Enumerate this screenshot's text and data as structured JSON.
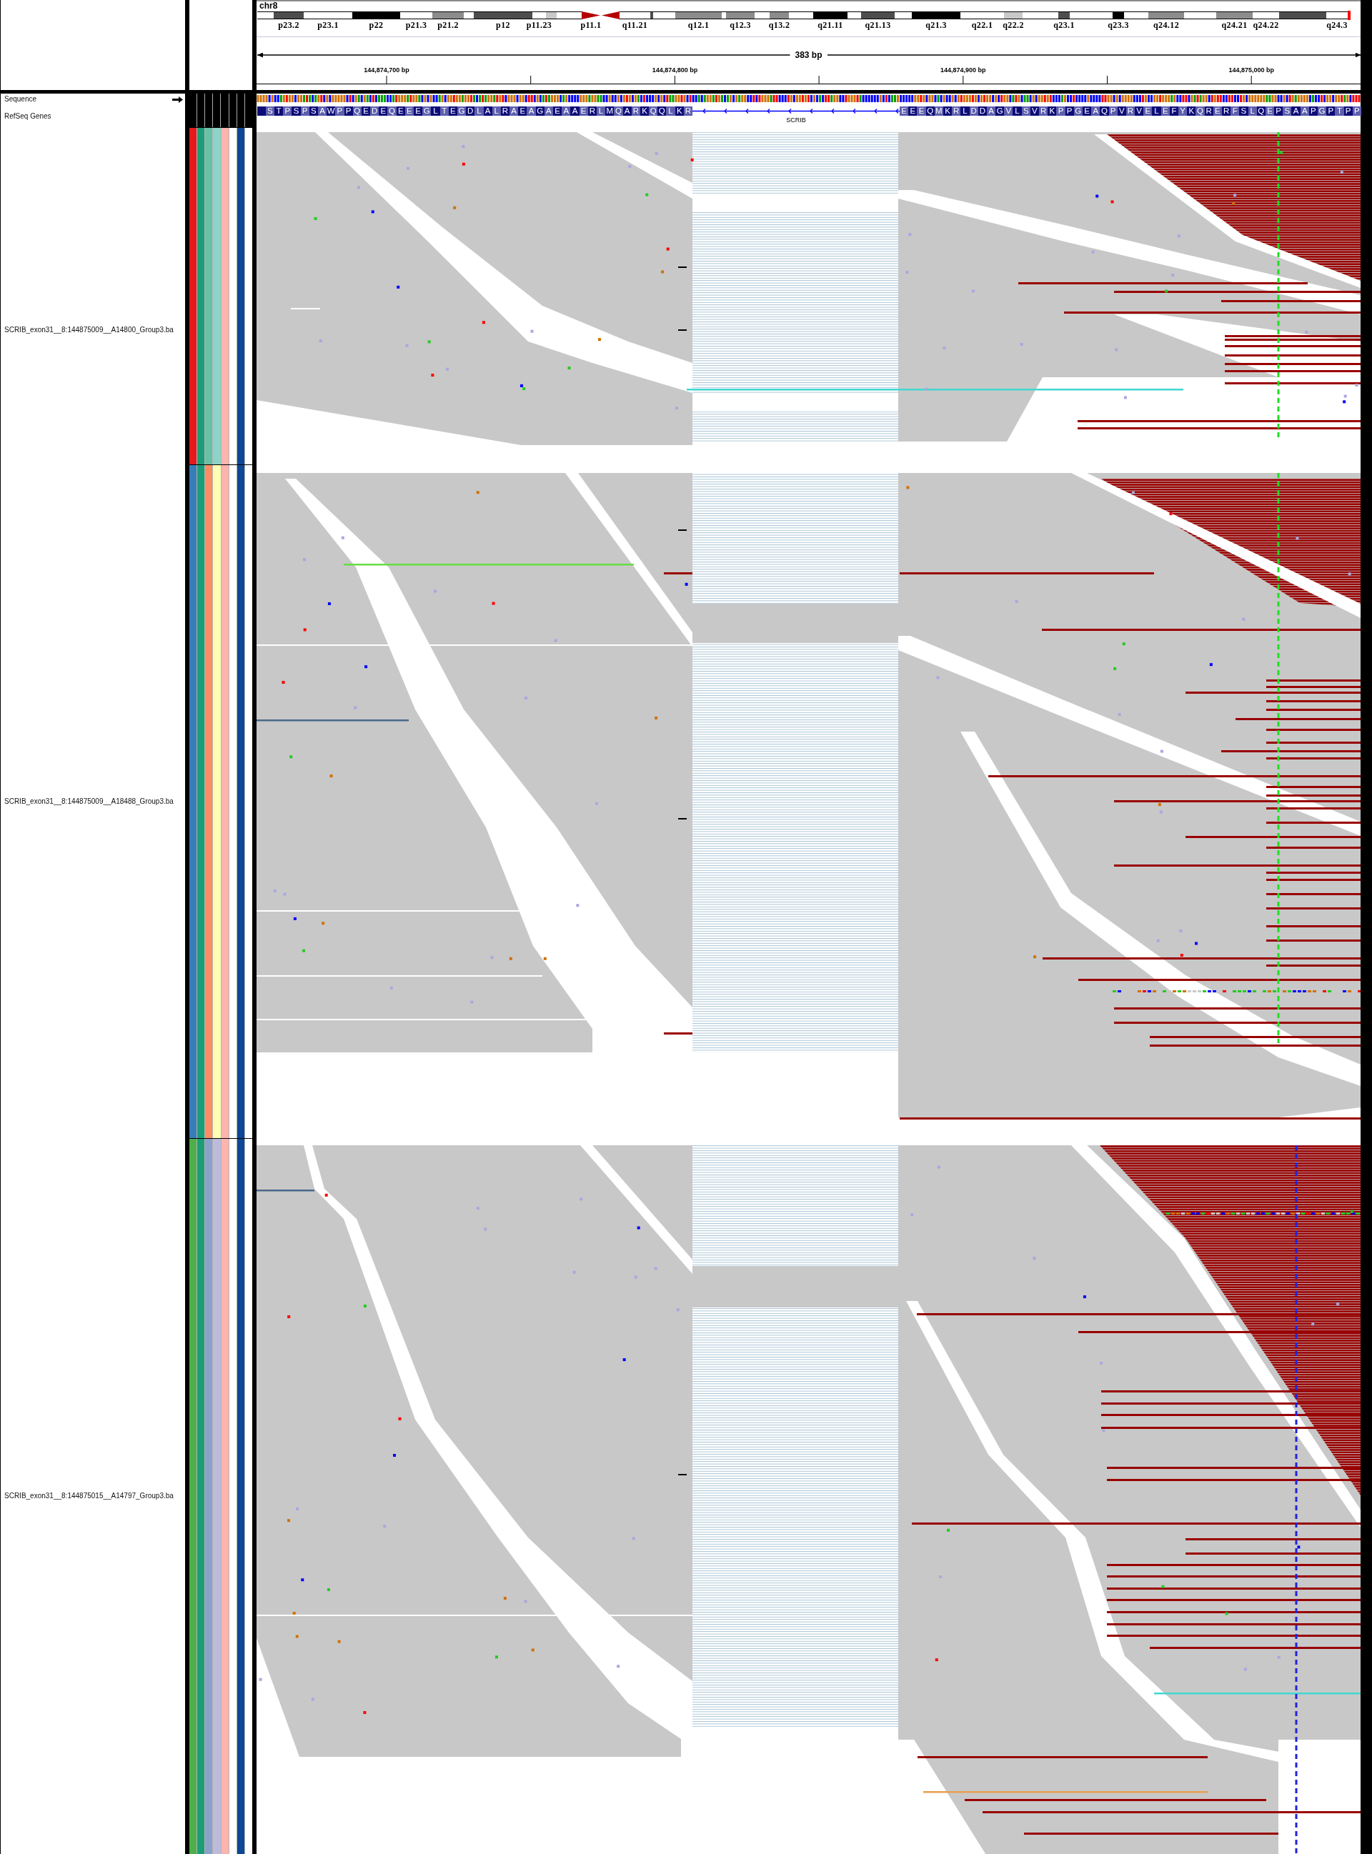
{
  "header": {
    "chromosome": "chr8",
    "ideogram": {
      "bands": [
        {
          "kind": "blank"
        },
        {
          "kind": "band",
          "color": "#4d4d4d",
          "label": "p23.2"
        },
        {
          "kind": "blank",
          "label": "p23.1"
        },
        {
          "kind": "band",
          "color": "#000000",
          "label": "p22"
        },
        {
          "kind": "blank",
          "label": "p21.3"
        },
        {
          "kind": "band",
          "color": "#8c8c8c",
          "label": "p21.2"
        },
        {
          "kind": "blank"
        },
        {
          "kind": "band",
          "color": "#4d4d4d",
          "label": "p12"
        },
        {
          "kind": "blank",
          "label": "p11.23"
        },
        {
          "kind": "band",
          "color": "#c8c8c8"
        },
        {
          "kind": "blank"
        },
        {
          "kind": "centromere",
          "color": "#b40000",
          "label": "p11.1"
        },
        {
          "kind": "centromere",
          "color": "#b40000"
        },
        {
          "kind": "blank",
          "label": "q11.21"
        },
        {
          "kind": "band",
          "color": "#4d4d4d"
        },
        {
          "kind": "blank"
        },
        {
          "kind": "band",
          "color": "#8c8c8c",
          "label": "q12.1"
        },
        {
          "kind": "blank"
        },
        {
          "kind": "band",
          "color": "#8c8c8c",
          "label": "q12.3"
        },
        {
          "kind": "blank"
        },
        {
          "kind": "band",
          "color": "#8c8c8c",
          "label": "q13.2"
        },
        {
          "kind": "blank"
        },
        {
          "kind": "band",
          "color": "#000000",
          "label": "q21.11"
        },
        {
          "kind": "blank"
        },
        {
          "kind": "band",
          "color": "#4d4d4d",
          "label": "q21.13"
        },
        {
          "kind": "blank"
        },
        {
          "kind": "band",
          "color": "#000000",
          "label": "q21.3"
        },
        {
          "kind": "blank",
          "label": "q22.1"
        },
        {
          "kind": "band",
          "color": "#c8c8c8",
          "label": "q22.2"
        },
        {
          "kind": "blank"
        },
        {
          "kind": "band",
          "color": "#4d4d4d",
          "label": "q23.1"
        },
        {
          "kind": "blank"
        },
        {
          "kind": "band",
          "color": "#000000",
          "label": "q23.3"
        },
        {
          "kind": "blank"
        },
        {
          "kind": "band",
          "color": "#8c8c8c",
          "label": "q24.12"
        },
        {
          "kind": "blank"
        },
        {
          "kind": "band",
          "color": "#8c8c8c",
          "label": "q24.21"
        },
        {
          "kind": "blank",
          "label": "q24.22"
        },
        {
          "kind": "band",
          "color": "#4d4d4d"
        },
        {
          "kind": "blank",
          "label": "q24.3"
        }
      ]
    },
    "ruler": {
      "span": "383 bp",
      "ticks": [
        "144,874,700 bp",
        "144,874,800 bp",
        "144,874,900 bp",
        "144,875,000 bp"
      ]
    }
  },
  "tracks": [
    {
      "kind": "sequence",
      "name": "Sequence"
    },
    {
      "kind": "gene",
      "name": "RefSeq Genes",
      "gene": "SCRIB",
      "exons": [
        "S T P S P S A W P P Q E D E Q E E E G L T E G D L A L R A E A G A E A A E R L M Q A R K Q Q L K R",
        "E E E Q M K R L D D A G V L S V R K P P G E A Q P V R V E L E F Y K Q R E R F S L Q E P S A A P G P T P P"
      ]
    },
    {
      "kind": "alignment",
      "name": "SCRIB_exon31__8:144875009__A14800_Group3.ba",
      "attributes": [
        {
          "color": "#e41a1c"
        },
        {
          "color": "#1b9e77"
        },
        {
          "color": "#66c2a5"
        },
        {
          "color": "#8dd3c7"
        },
        {
          "color": "#fbb4ae"
        },
        {
          "color": "#ffffff"
        },
        {
          "color": "#0c4896"
        },
        {
          "color": "#ffffff"
        }
      ]
    },
    {
      "kind": "alignment",
      "name": "SCRIB_exon31__8:144875009__A18488_Group3.ba",
      "attributes": [
        {
          "color": "#377eb8"
        },
        {
          "color": "#1b9e77"
        },
        {
          "color": "#fc8d62"
        },
        {
          "color": "#ffffb3"
        },
        {
          "color": "#fbb4ae"
        },
        {
          "color": "#ffffff"
        },
        {
          "color": "#0c4896"
        },
        {
          "color": "#ffffff"
        }
      ]
    },
    {
      "kind": "alignment",
      "name": "SCRIB_exon31__8:144875015__A14797_Group3.ba",
      "attributes": [
        {
          "color": "#4daf4a"
        },
        {
          "color": "#1b9e77"
        },
        {
          "color": "#8da0cb"
        },
        {
          "color": "#bebada"
        },
        {
          "color": "#fbb4ae"
        },
        {
          "color": "#ffffff"
        },
        {
          "color": "#0c4896"
        },
        {
          "color": "#ffffff"
        }
      ]
    }
  ]
}
